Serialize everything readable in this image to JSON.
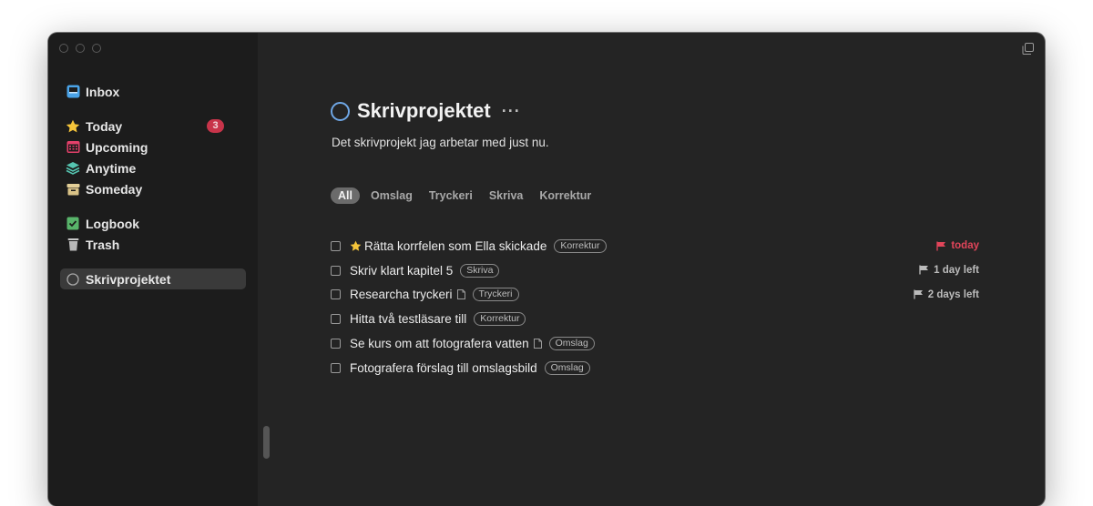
{
  "sidebar": {
    "items": [
      {
        "key": "inbox",
        "label": "Inbox",
        "icon": "inbox-icon"
      },
      {
        "key": "today",
        "label": "Today",
        "icon": "star-icon",
        "badge": "3"
      },
      {
        "key": "upcoming",
        "label": "Upcoming",
        "icon": "calendar-icon"
      },
      {
        "key": "anytime",
        "label": "Anytime",
        "icon": "layers-icon"
      },
      {
        "key": "someday",
        "label": "Someday",
        "icon": "archive-box-icon"
      },
      {
        "key": "logbook",
        "label": "Logbook",
        "icon": "logbook-check-icon"
      },
      {
        "key": "trash",
        "label": "Trash",
        "icon": "trash-icon"
      },
      {
        "key": "project",
        "label": "Skrivprojektet",
        "icon": "project-circle-icon",
        "selected": true
      }
    ]
  },
  "project": {
    "title": "Skrivprojektet",
    "more": "···",
    "notes": "Det skrivprojekt jag arbetar med just nu."
  },
  "filters": [
    "All",
    "Omslag",
    "Tryckeri",
    "Skriva",
    "Korrektur"
  ],
  "todos": [
    {
      "title": "Rätta korrfelen som Ella skickade",
      "tag": "Korrektur",
      "starred": true,
      "deadline": "today",
      "overdue": true
    },
    {
      "title": "Skriv klart kapitel 5",
      "tag": "Skriva",
      "deadline": "1 day left"
    },
    {
      "title": "Researcha tryckeri",
      "tag": "Tryckeri",
      "has_note": true,
      "deadline": "2 days left"
    },
    {
      "title": "Hitta två testläsare till",
      "tag": "Korrektur"
    },
    {
      "title": "Se kurs om att fotografera vatten",
      "tag": "Omslag",
      "has_note": true
    },
    {
      "title": "Fotografera förslag till omslagsbild",
      "tag": "Omslag"
    }
  ],
  "colors": {
    "accent_blue": "#6fa7e6",
    "today_red": "#e2455a",
    "star_yellow": "#f5c53a",
    "badge": "#c8344a"
  }
}
